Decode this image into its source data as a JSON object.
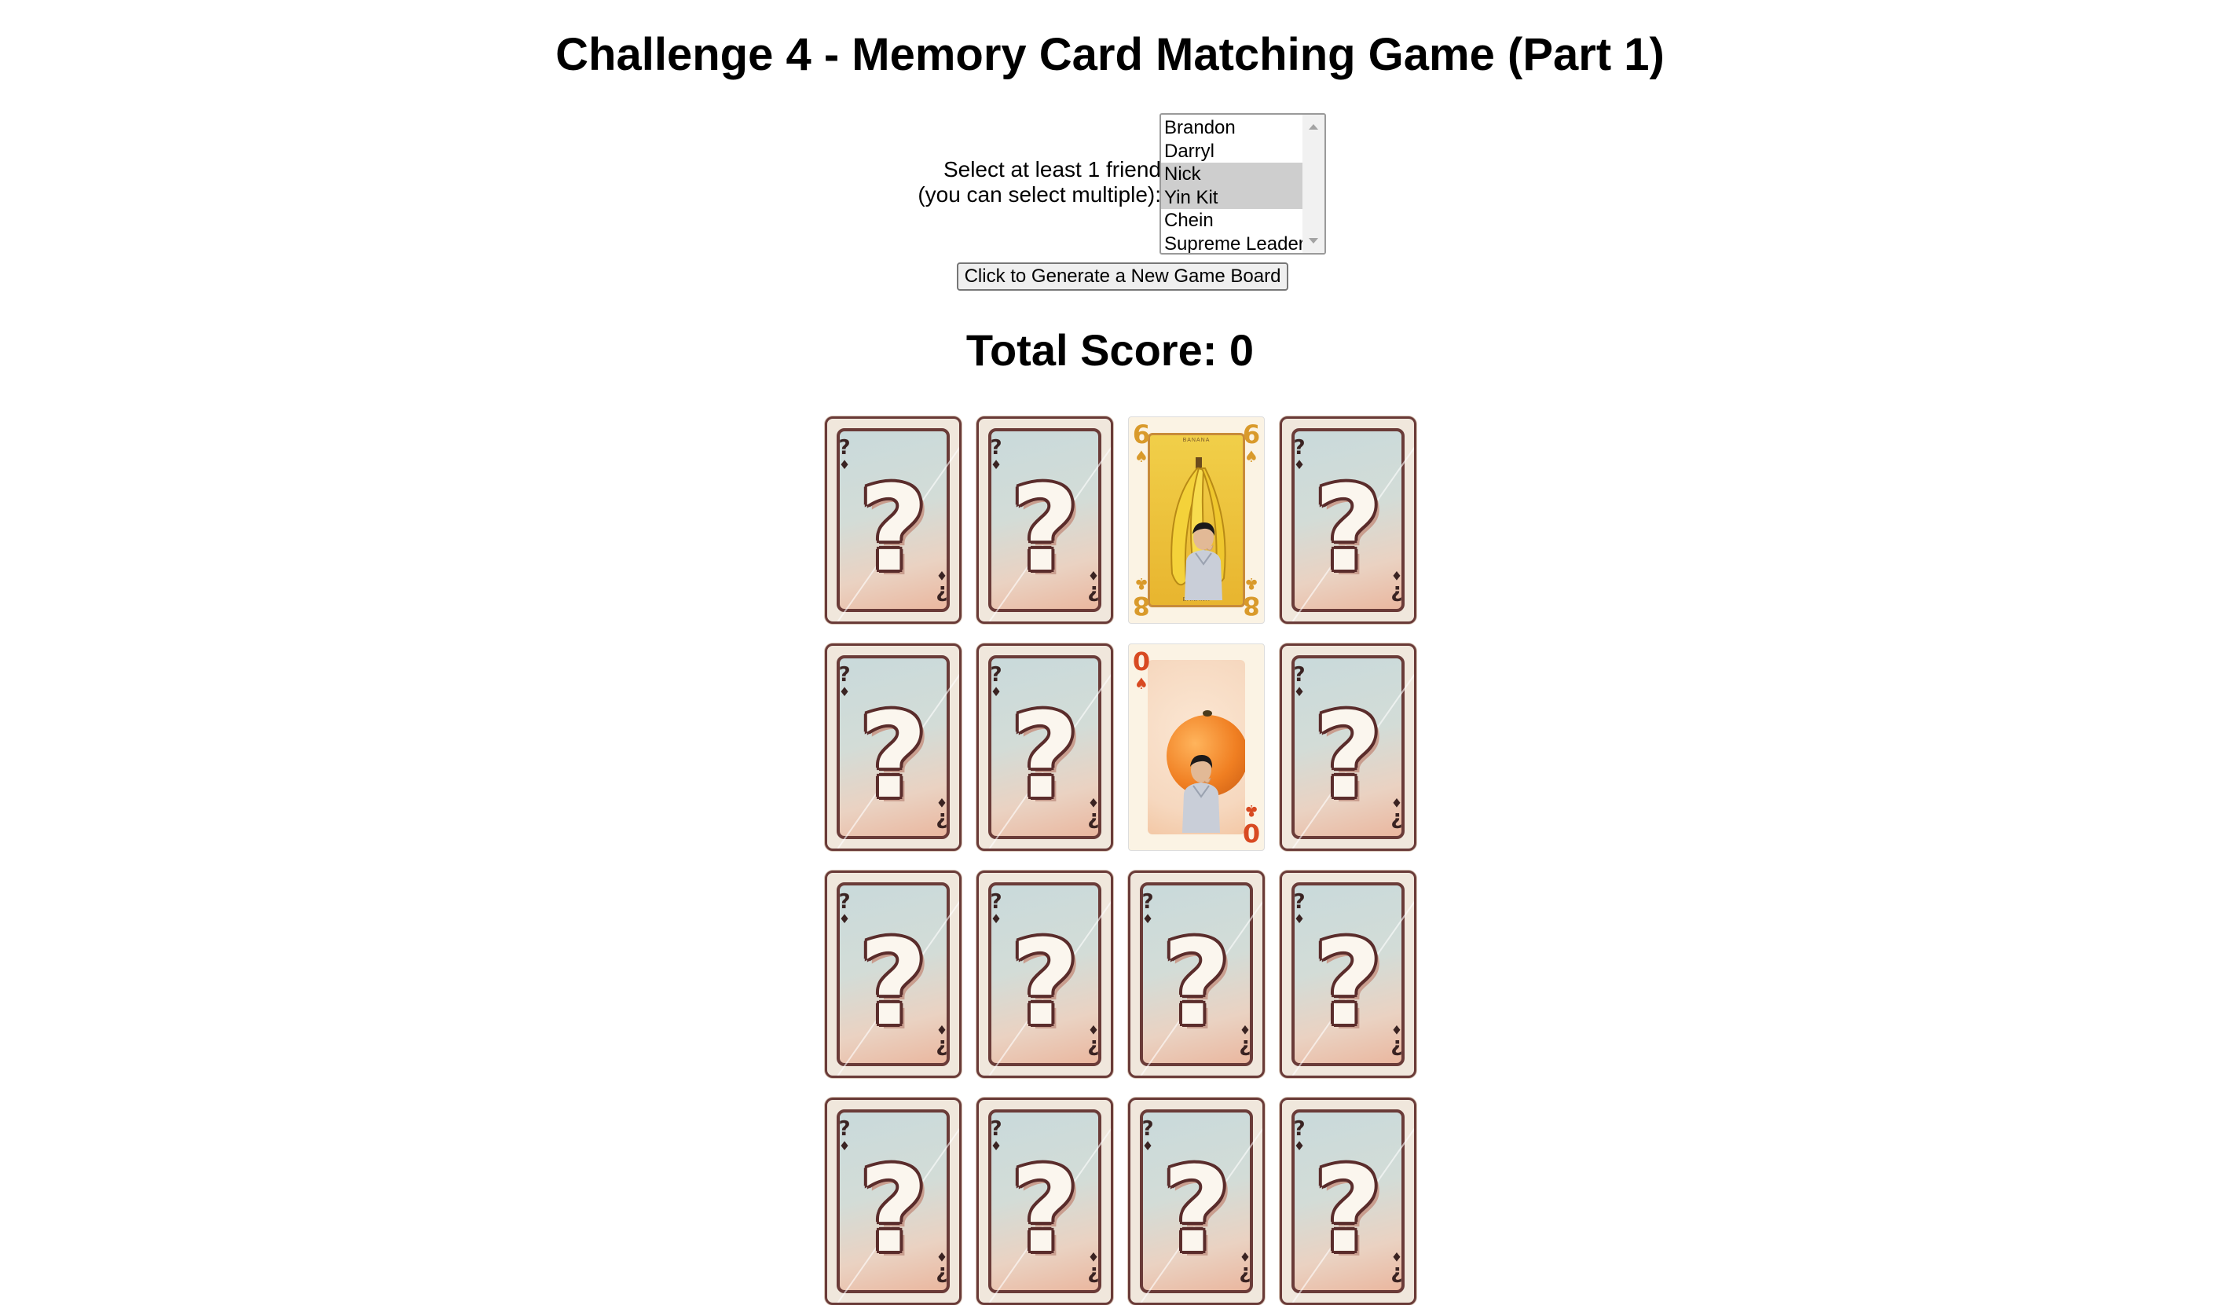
{
  "page": {
    "title": "Challenge 4 - Memory Card Matching Game (Part 1)"
  },
  "friend_picker": {
    "label_line1": "Select at least 1 friend",
    "label_line2": "(you can select multiple):",
    "options": [
      {
        "label": "Brandon",
        "selected": false
      },
      {
        "label": "Darryl",
        "selected": false
      },
      {
        "label": "Nick",
        "selected": true
      },
      {
        "label": "Yin Kit",
        "selected": true
      },
      {
        "label": "Chein",
        "selected": false
      },
      {
        "label": "Supreme Leader",
        "selected": false
      }
    ]
  },
  "generate_button": {
    "label": "Click to Generate a New Game Board"
  },
  "score": {
    "label": "Total Score: ",
    "value": "0"
  },
  "board": {
    "columns": 4,
    "rows_visible": 4,
    "cards": [
      {
        "state": "face-down"
      },
      {
        "state": "face-down"
      },
      {
        "state": "face-up",
        "fruit": "banana",
        "rank": "6"
      },
      {
        "state": "face-down"
      },
      {
        "state": "face-down"
      },
      {
        "state": "face-down"
      },
      {
        "state": "face-up",
        "fruit": "orange",
        "rank": "0"
      },
      {
        "state": "face-down"
      },
      {
        "state": "face-down"
      },
      {
        "state": "face-down"
      },
      {
        "state": "face-down"
      },
      {
        "state": "face-down"
      },
      {
        "state": "face-down"
      },
      {
        "state": "face-down"
      },
      {
        "state": "face-down"
      },
      {
        "state": "face-down"
      }
    ]
  },
  "card_back": {
    "symbol": "?",
    "corner_mark": "?",
    "corner_suit": "♦",
    "colors": {
      "outline": "#6a3b38",
      "top": "#c9dadb",
      "bottom": "#eab79f"
    }
  },
  "banana_card": {
    "rank_top": "6",
    "rank_bottom": "8",
    "suit": "♠",
    "bottom_suit": "♣",
    "caption_top": "BANANA",
    "caption_bottom": "BANANA"
  },
  "orange_card": {
    "rank_top": "0",
    "rank_bottom": "0",
    "suit": "♠",
    "bottom_suit": "♣"
  }
}
